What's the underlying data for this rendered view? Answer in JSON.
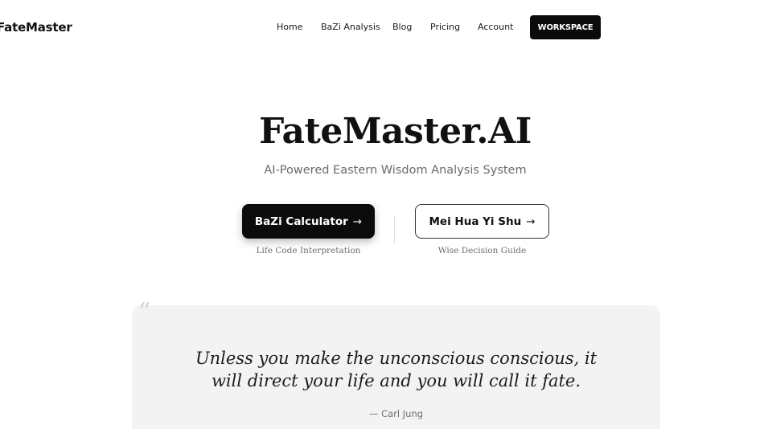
{
  "header": {
    "logo": "FateMaster",
    "nav": {
      "home": "Home",
      "bazi_analysis": "BaZi Analysis",
      "blog": "Blog",
      "pricing": "Pricing",
      "account": "Account",
      "workspace": "WORKSPACE"
    }
  },
  "hero": {
    "title": "FateMaster.AI",
    "subtitle": "AI-Powered Eastern Wisdom Analysis System"
  },
  "actions": {
    "bazi": {
      "label": "BaZi Calculator",
      "arrow": "→",
      "caption": "Life Code Interpretation"
    },
    "mei_hua": {
      "label": "Mei Hua Yi Shu",
      "arrow": "→",
      "caption": "Wise Decision Guide"
    }
  },
  "quote": {
    "mark": "“",
    "line1": "Unless you make the unconscious conscious, it",
    "line2": "will direct your life and you will call it fate.",
    "author": "— Carl Jung"
  },
  "colors": {
    "primary": "#0b0b0b",
    "background": "#ffffff",
    "card": "#f3f3f3",
    "muted_text": "#6b6b6b"
  }
}
